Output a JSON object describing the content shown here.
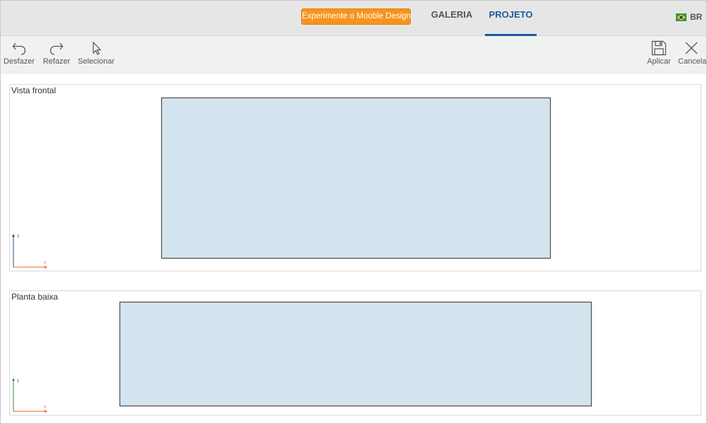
{
  "header": {
    "promo_button": "Experimente o Mooble Design",
    "tabs": [
      {
        "label": "GALERIA",
        "active": false
      },
      {
        "label": "PROJETO",
        "active": true
      }
    ],
    "language": {
      "code": "BR",
      "flag_icon": "brazil-flag-icon"
    }
  },
  "toolbar": {
    "undo_label": "Desfazer",
    "redo_label": "Refazer",
    "select_label": "Selecionar",
    "apply_label": "Aplicar",
    "cancel_label": "Cancelar"
  },
  "views": {
    "front": {
      "title": "Vista frontal",
      "axis_h": "x",
      "axis_v": "z"
    },
    "plan": {
      "title": "Planta baixa",
      "axis_h": "x",
      "axis_v": "y"
    }
  },
  "colors": {
    "accent": "#1a5b9e",
    "promo": "#f7931e",
    "shape_fill": "#d4e4ee",
    "axis_x": "#e8622a",
    "axis_z": "#2b4e8c",
    "axis_y": "#2e8b3e"
  }
}
